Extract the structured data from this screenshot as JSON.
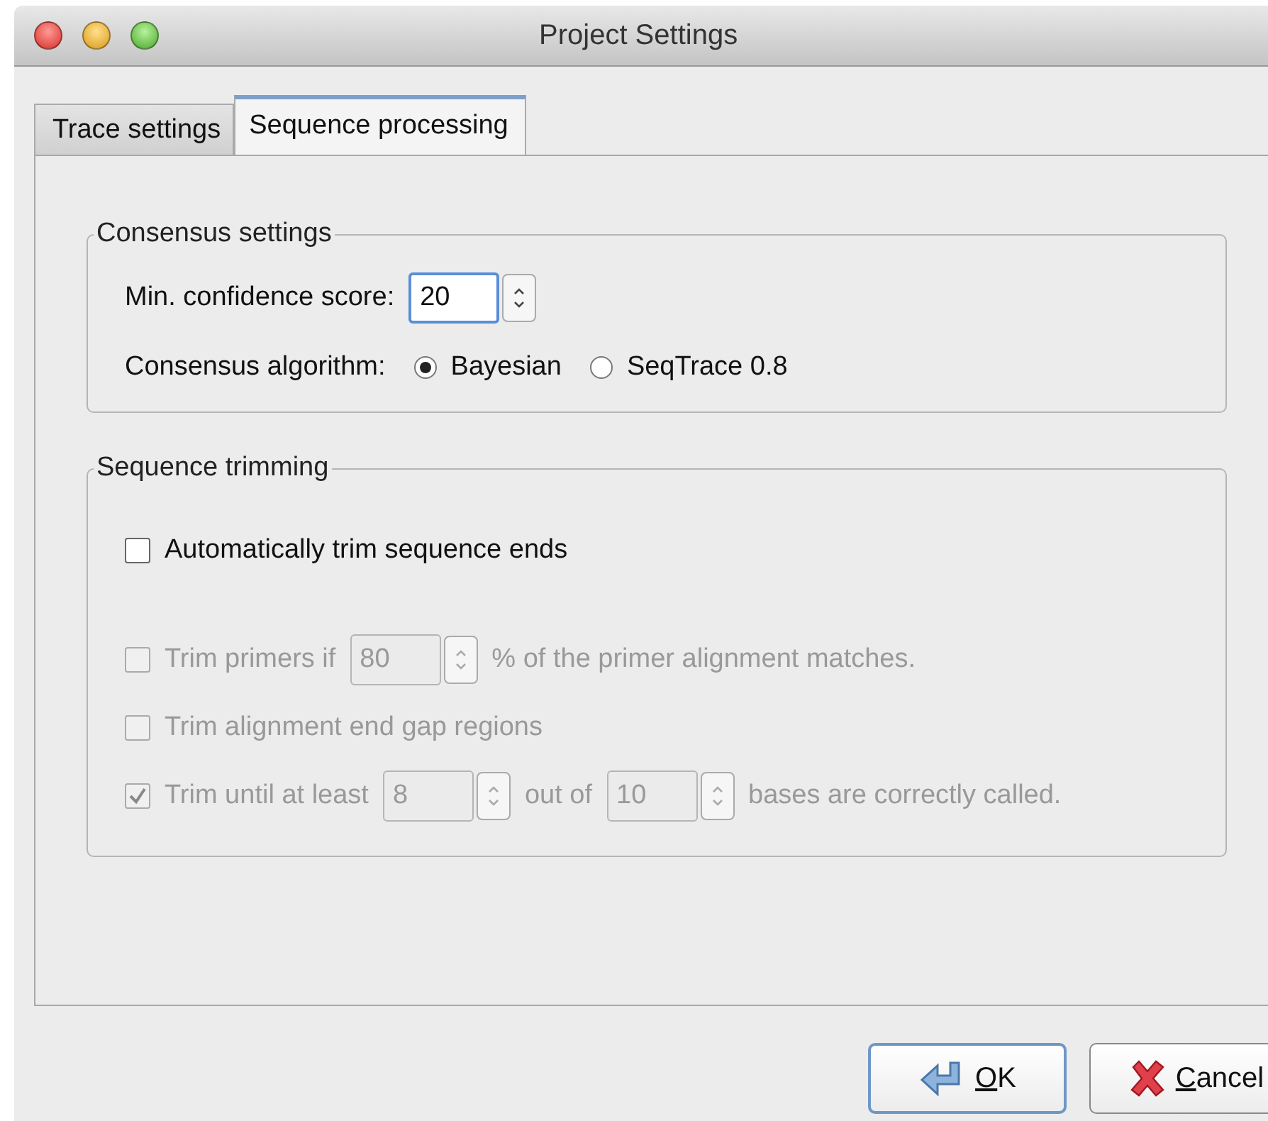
{
  "window": {
    "title": "Project Settings"
  },
  "tabs": [
    {
      "label": "Trace settings",
      "selected": false
    },
    {
      "label": "Sequence processing",
      "selected": true
    }
  ],
  "consensus": {
    "title": "Consensus settings",
    "min_score": {
      "label": "Min. confidence score:",
      "value": "20"
    },
    "algorithm": {
      "label": "Consensus algorithm:",
      "options": [
        {
          "label": "Bayesian",
          "selected": true
        },
        {
          "label": "SeqTrace 0.8",
          "selected": false
        }
      ]
    }
  },
  "trimming": {
    "title": "Sequence trimming",
    "auto_trim": {
      "label": "Automatically trim sequence ends",
      "checked": false,
      "disabled": false
    },
    "rows": [
      {
        "checked": false,
        "disabled": true,
        "parts": [
          {
            "kind": "text",
            "text": "Trim primers if"
          },
          {
            "kind": "spin",
            "value": "80"
          },
          {
            "kind": "text",
            "text": "% of the primer alignment matches."
          }
        ]
      },
      {
        "checked": false,
        "disabled": true,
        "parts": [
          {
            "kind": "text",
            "text": "Trim alignment end gap regions"
          }
        ]
      },
      {
        "checked": true,
        "disabled": true,
        "parts": [
          {
            "kind": "text",
            "text": "Trim until at least"
          },
          {
            "kind": "spin",
            "value": "8"
          },
          {
            "kind": "text",
            "text": "out of"
          },
          {
            "kind": "spin",
            "value": "10"
          },
          {
            "kind": "text",
            "text": "bases are correctly called."
          }
        ]
      }
    ]
  },
  "buttons": [
    {
      "label": "OK",
      "kind": "ok",
      "default": true
    },
    {
      "label": "Cancel",
      "kind": "cancel",
      "default": false
    }
  ]
}
